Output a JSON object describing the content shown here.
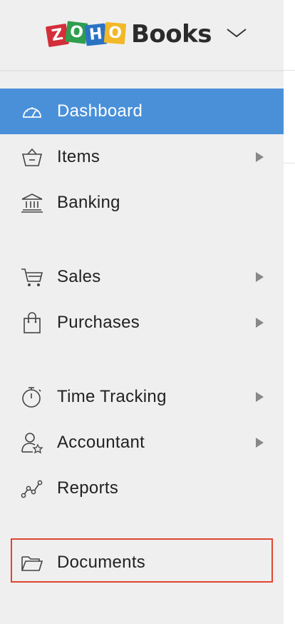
{
  "header": {
    "logo_letters": [
      "Z",
      "O",
      "H",
      "O"
    ],
    "product_name": "Books",
    "logo_colors": [
      "#d32f3a",
      "#2f9e4f",
      "#2a73c4",
      "#f2b829"
    ]
  },
  "nav": {
    "active_color": "#4a90d9",
    "highlight_color": "#e0452e",
    "items": [
      {
        "label": "Dashboard",
        "icon": "speedometer-icon",
        "active": true,
        "submenu": false
      },
      {
        "label": "Items",
        "icon": "basket-icon",
        "active": false,
        "submenu": true
      },
      {
        "label": "Banking",
        "icon": "bank-icon",
        "active": false,
        "submenu": false
      },
      {
        "label": "Sales",
        "icon": "shopping-cart-icon",
        "active": false,
        "submenu": true
      },
      {
        "label": "Purchases",
        "icon": "shopping-bag-icon",
        "active": false,
        "submenu": true
      },
      {
        "label": "Time Tracking",
        "icon": "stopwatch-icon",
        "active": false,
        "submenu": true
      },
      {
        "label": "Accountant",
        "icon": "user-star-icon",
        "active": false,
        "submenu": true
      },
      {
        "label": "Reports",
        "icon": "line-chart-icon",
        "active": false,
        "submenu": false
      },
      {
        "label": "Documents",
        "icon": "folder-icon",
        "active": false,
        "submenu": false,
        "highlighted": true
      }
    ]
  }
}
